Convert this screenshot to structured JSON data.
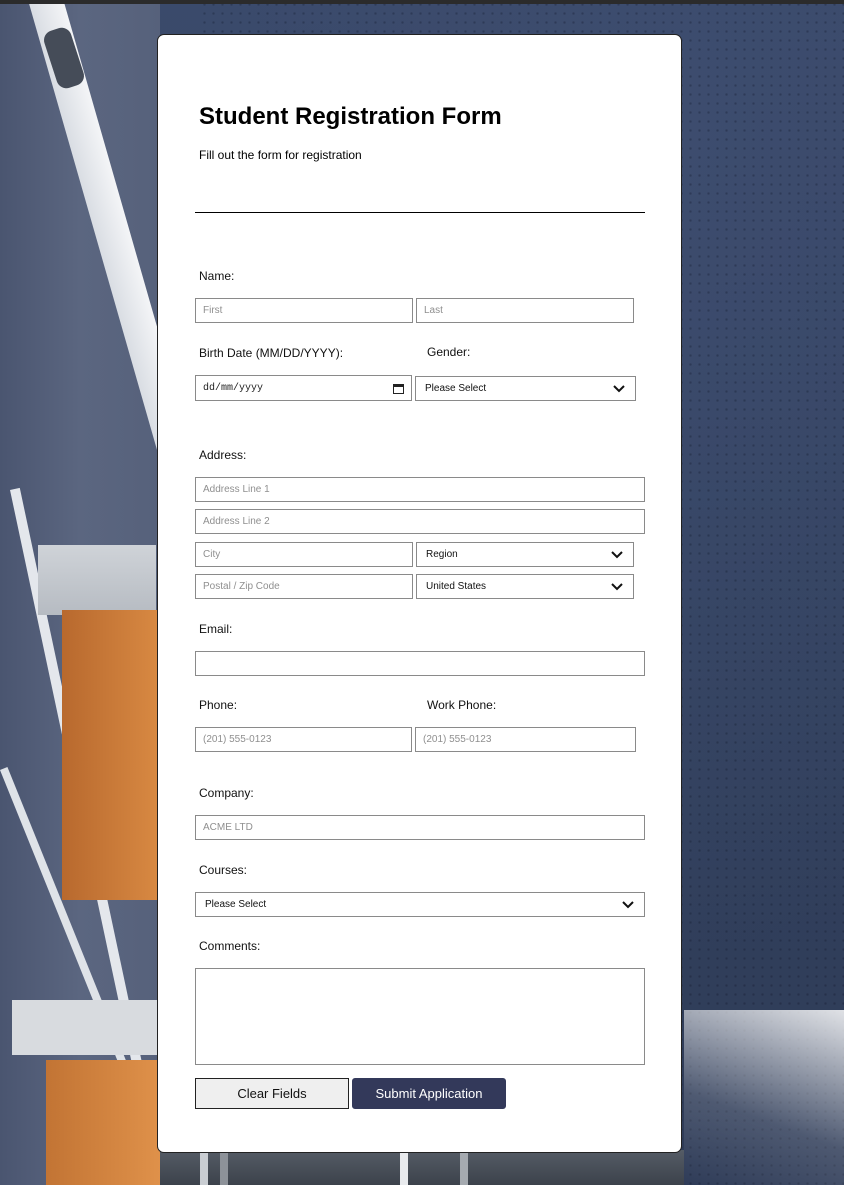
{
  "form": {
    "title": "Student Registration Form",
    "subtitle": "Fill out the form for registration"
  },
  "name": {
    "label": "Name:",
    "first_placeholder": "First",
    "last_placeholder": "Last"
  },
  "birth_date": {
    "label": "Birth Date (MM/DD/YYYY):",
    "value_format": "dd/mm/yyyy"
  },
  "gender": {
    "label": "Gender:",
    "selected": "Please Select"
  },
  "address": {
    "label": "Address:",
    "line1_placeholder": "Address Line 1",
    "line2_placeholder": "Address Line 2",
    "city_placeholder": "City",
    "region_selected": "Region",
    "postal_placeholder": "Postal / Zip Code",
    "country_selected": "United States"
  },
  "email": {
    "label": "Email:",
    "value": ""
  },
  "phone": {
    "label": "Phone:",
    "placeholder": "(201) 555-0123"
  },
  "work_phone": {
    "label": "Work Phone:",
    "placeholder": "(201) 555-0123"
  },
  "company": {
    "label": "Company:",
    "placeholder": "ACME LTD"
  },
  "courses": {
    "label": "Courses:",
    "selected": "Please Select"
  },
  "comments": {
    "label": "Comments:",
    "value": ""
  },
  "buttons": {
    "clear": "Clear Fields",
    "submit": "Submit Application"
  },
  "colors": {
    "submit_bg": "#33395a",
    "clear_bg": "#efefef",
    "card_bg": "#ffffff",
    "field_border": "#8a8a8a"
  },
  "icons": {
    "select_arrow": "chevron-down-icon",
    "date_picker": "calendar-icon"
  }
}
